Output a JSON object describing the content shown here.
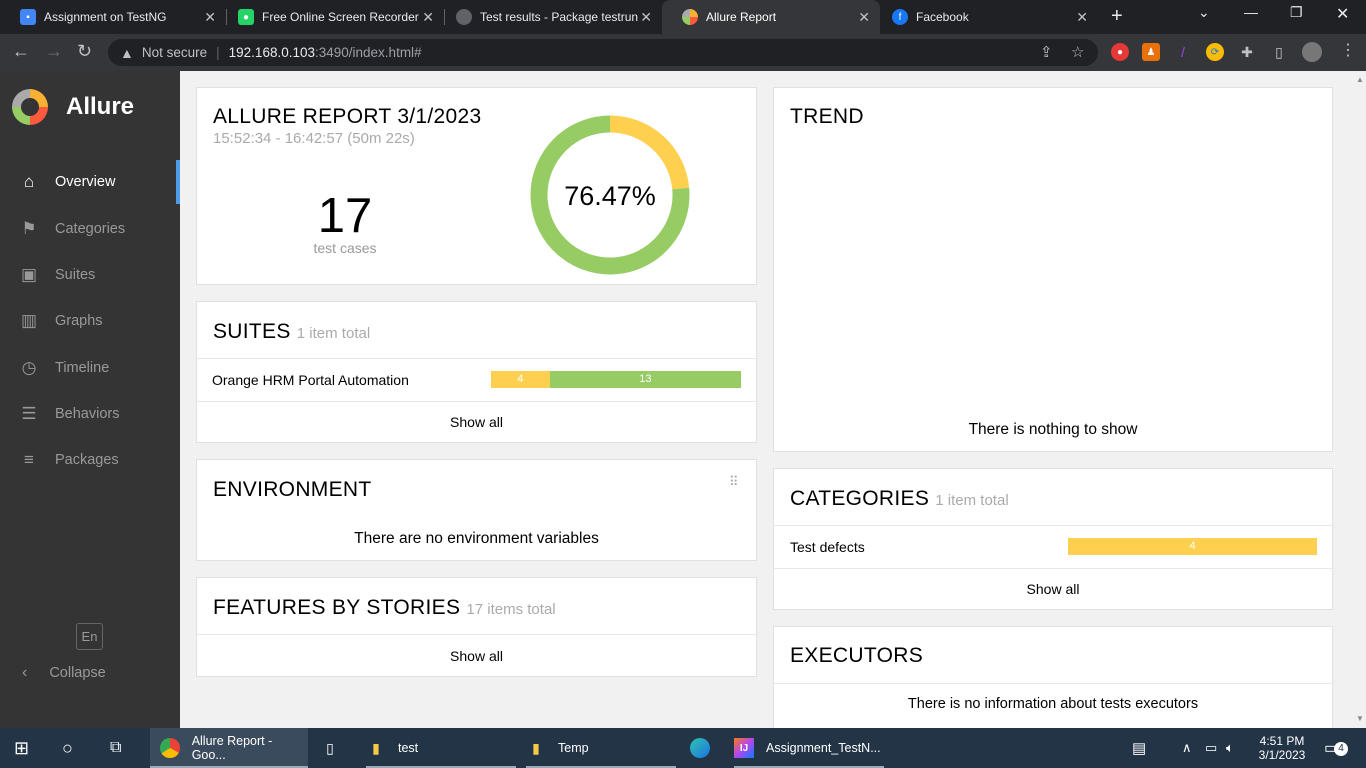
{
  "browser": {
    "tabs": [
      {
        "title": "Assignment on TestNG",
        "icon": "google-form-icon",
        "color": "#4285f4"
      },
      {
        "title": "Free Online Screen Recorder |",
        "icon": "screen-recorder-icon",
        "color": "#25d366"
      },
      {
        "title": "Test results - Package testrun",
        "icon": "globe-icon",
        "color": "#5f6368"
      },
      {
        "title": "Allure Report",
        "icon": "allure-icon",
        "color": "#97cc64"
      },
      {
        "title": "Facebook",
        "icon": "facebook-icon",
        "color": "#1877f2"
      }
    ],
    "address": {
      "security": "Not secure",
      "host": "192.168.0.103",
      "path": ":3490/index.html#"
    }
  },
  "sidebar": {
    "brand": "Allure",
    "items": [
      {
        "label": "Overview",
        "icon": "home-icon"
      },
      {
        "label": "Categories",
        "icon": "flag-icon"
      },
      {
        "label": "Suites",
        "icon": "briefcase-icon"
      },
      {
        "label": "Graphs",
        "icon": "bar-chart-icon"
      },
      {
        "label": "Timeline",
        "icon": "clock-icon"
      },
      {
        "label": "Behaviors",
        "icon": "list-icon"
      },
      {
        "label": "Packages",
        "icon": "align-left-icon"
      }
    ],
    "language": "En",
    "collapse": "Collapse"
  },
  "summary": {
    "title": "ALLURE REPORT 3/1/2023",
    "time": "15:52:34 - 16:42:57 (50m 22s)",
    "count": "17",
    "count_label": "test cases",
    "percent": "76.47%",
    "passed": 13,
    "broken": 4
  },
  "suites": {
    "title": "SUITES",
    "subtitle": "1 item total",
    "rows": [
      {
        "name": "Orange HRM Portal Automation",
        "broken": "4",
        "passed": "13"
      }
    ],
    "show_all": "Show all"
  },
  "environment": {
    "title": "ENVIRONMENT",
    "empty": "There are no environment variables"
  },
  "features": {
    "title": "FEATURES BY STORIES",
    "subtitle": "17 items total",
    "show_all": "Show all"
  },
  "trend": {
    "title": "TREND",
    "empty": "There is nothing to show"
  },
  "categories": {
    "title": "CATEGORIES",
    "subtitle": "1 item total",
    "rows": [
      {
        "name": "Test defects",
        "count": "4"
      }
    ],
    "show_all": "Show all"
  },
  "executors": {
    "title": "EXECUTORS",
    "empty": "There is no information about tests executors"
  },
  "colors": {
    "passed": "#97cc64",
    "broken": "#ffd050",
    "sidebar": "#343434",
    "accent": "#4e9ae8"
  },
  "taskbar": {
    "items": [
      {
        "label": "Allure Report - Goo...",
        "icon": "chrome-icon"
      },
      {
        "label": "",
        "icon": "file-icon"
      },
      {
        "label": "test",
        "icon": "folder-icon"
      },
      {
        "label": "Temp",
        "icon": "folder-icon"
      },
      {
        "label": "",
        "icon": "edge-icon"
      },
      {
        "label": "Assignment_TestN...",
        "icon": "intellij-icon"
      }
    ],
    "time": "4:51 PM",
    "date": "3/1/2023",
    "notifications": "4"
  }
}
